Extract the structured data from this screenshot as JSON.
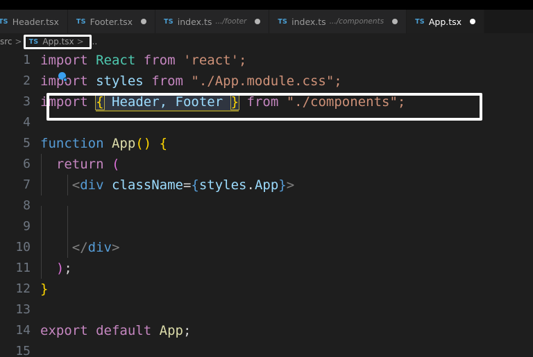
{
  "window": {
    "title": "App.tsx"
  },
  "tabs": [
    {
      "icon": "TS",
      "label": "Header.tsx",
      "path": "",
      "dirty": false,
      "active": false,
      "clipped": true
    },
    {
      "icon": "TS",
      "label": "Footer.tsx",
      "path": "",
      "dirty": true,
      "active": false,
      "clipped": false
    },
    {
      "icon": "TS",
      "label": "index.ts",
      "path": ".../footer",
      "dirty": true,
      "active": false,
      "clipped": false
    },
    {
      "icon": "TS",
      "label": "index.ts",
      "path": ".../components",
      "dirty": true,
      "active": false,
      "clipped": false
    },
    {
      "icon": "TS",
      "label": "App.tsx",
      "path": "",
      "dirty": true,
      "active": true,
      "clipped": false
    }
  ],
  "breadcrumb": {
    "root": "src",
    "separator": ">",
    "file_icon": "TS",
    "file": "App.tsx",
    "file_separator": ">",
    "trailing": "..."
  },
  "colors": {
    "editor_background": "#1e1e1e",
    "tabbar_background": "#191919",
    "active_tab_background": "#1f1f1f",
    "inactive_tab_background": "#252526",
    "ts_badge": "#4a9fd4",
    "highlight_border": "#ffffff",
    "bracket_match_border": "#b5a642",
    "selection_underline": "#8a7f2a",
    "cursor_indicator": "#3aa0f0",
    "line_number": "#6e7681",
    "keyword": "#c586c0",
    "string": "#ce9178",
    "identifier": "#9cdcfe",
    "class_name": "#4ec9b0",
    "function_keyword": "#569cd6",
    "function_name": "#dcdcaa",
    "yellow_brace": "#ffd700",
    "magenta_paren": "#da70d6",
    "jsx_tag_bracket": "#808080"
  },
  "editor": {
    "language": "typescriptreact",
    "line_numbers": [
      "1",
      "2",
      "3",
      "4",
      "5",
      "6",
      "7",
      "8",
      "9",
      "10",
      "11",
      "12",
      "13",
      "14",
      "15"
    ],
    "lines": [
      {
        "n": "1",
        "text": "import React from 'react';"
      },
      {
        "n": "2",
        "text": "import styles from \"./App.module.css\";"
      },
      {
        "n": "3",
        "text": "import { Header, Footer } from \"./components\";"
      },
      {
        "n": "4",
        "text": ""
      },
      {
        "n": "5",
        "text": "function App() {"
      },
      {
        "n": "6",
        "text": "  return ("
      },
      {
        "n": "7",
        "text": "    <div className={styles.App}>"
      },
      {
        "n": "8",
        "text": ""
      },
      {
        "n": "9",
        "text": ""
      },
      {
        "n": "10",
        "text": "    </div>"
      },
      {
        "n": "11",
        "text": "  );"
      },
      {
        "n": "12",
        "text": "}"
      },
      {
        "n": "13",
        "text": ""
      },
      {
        "n": "14",
        "text": "export default App;"
      },
      {
        "n": "15",
        "text": ""
      }
    ],
    "tokens": {
      "l1_import": "import",
      "l1_react": "React",
      "l1_from": "from",
      "l1_module": "'react';",
      "l2_import": "import",
      "l2_styles": "styles",
      "l2_from": "from",
      "l2_module": "\"./App.module.css\";",
      "l3_import": "import",
      "l3_open_brace": "{",
      "l3_named": "Header, Footer",
      "l3_close_brace": "}",
      "l3_from": "from",
      "l3_module": "\"./components\";",
      "l5_function": "function",
      "l5_name": "App",
      "l5_parens": "()",
      "l5_brace": "{",
      "l6_return": "return",
      "l6_paren": "(",
      "l7_open": "<",
      "l7_tag": "div",
      "l7_space": " ",
      "l7_attr": "className",
      "l7_eq": "=",
      "l7_exp_open": "{",
      "l7_obj": "styles",
      "l7_dot": ".",
      "l7_prop": "App",
      "l7_exp_close": "}",
      "l7_close": ">",
      "l10_open": "</",
      "l10_tag": "div",
      "l10_close": ">",
      "l11_paren": ")",
      "l11_semi": ";",
      "l12_brace": "}",
      "l14_export": "export",
      "l14_default": "default",
      "l14_name": "App",
      "l14_semi": ";"
    }
  },
  "annotations": {
    "breadcrumb_focus_box": "white rectangle around breadcrumb file segment",
    "line3_focus_box": "white rectangle around line 3 import statement",
    "bracket_match": "yellow outline around matching curly braces on line 3",
    "cursor": "blue pointer indicator on line 2"
  }
}
